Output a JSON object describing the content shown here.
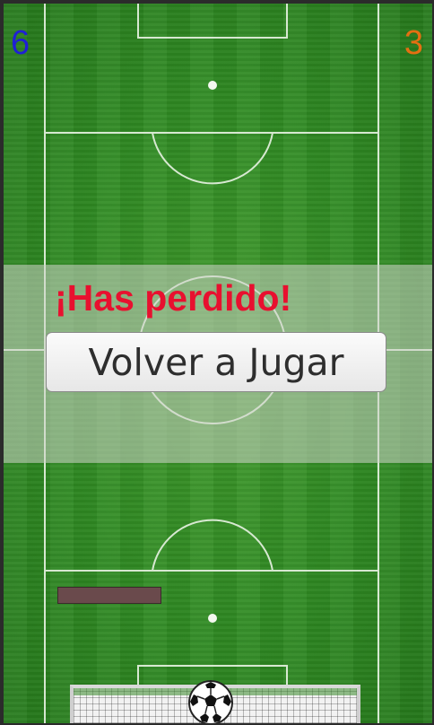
{
  "scoreboard": {
    "left_score": "6",
    "left_color": "#1f1fd6",
    "right_score": "3",
    "right_color": "#e56f12"
  },
  "game_over": {
    "message": "¡Has perdido!",
    "message_color": "#e8102f",
    "replay_button_label": "Volver a Jugar"
  },
  "field": {
    "grass_color": "#2f8a22",
    "line_color": "#ffffff"
  },
  "sprites": {
    "paddle_color": "#6a4a4c",
    "ball_icon": "soccer-ball-icon",
    "goal_icon": "goal-net-icon"
  }
}
